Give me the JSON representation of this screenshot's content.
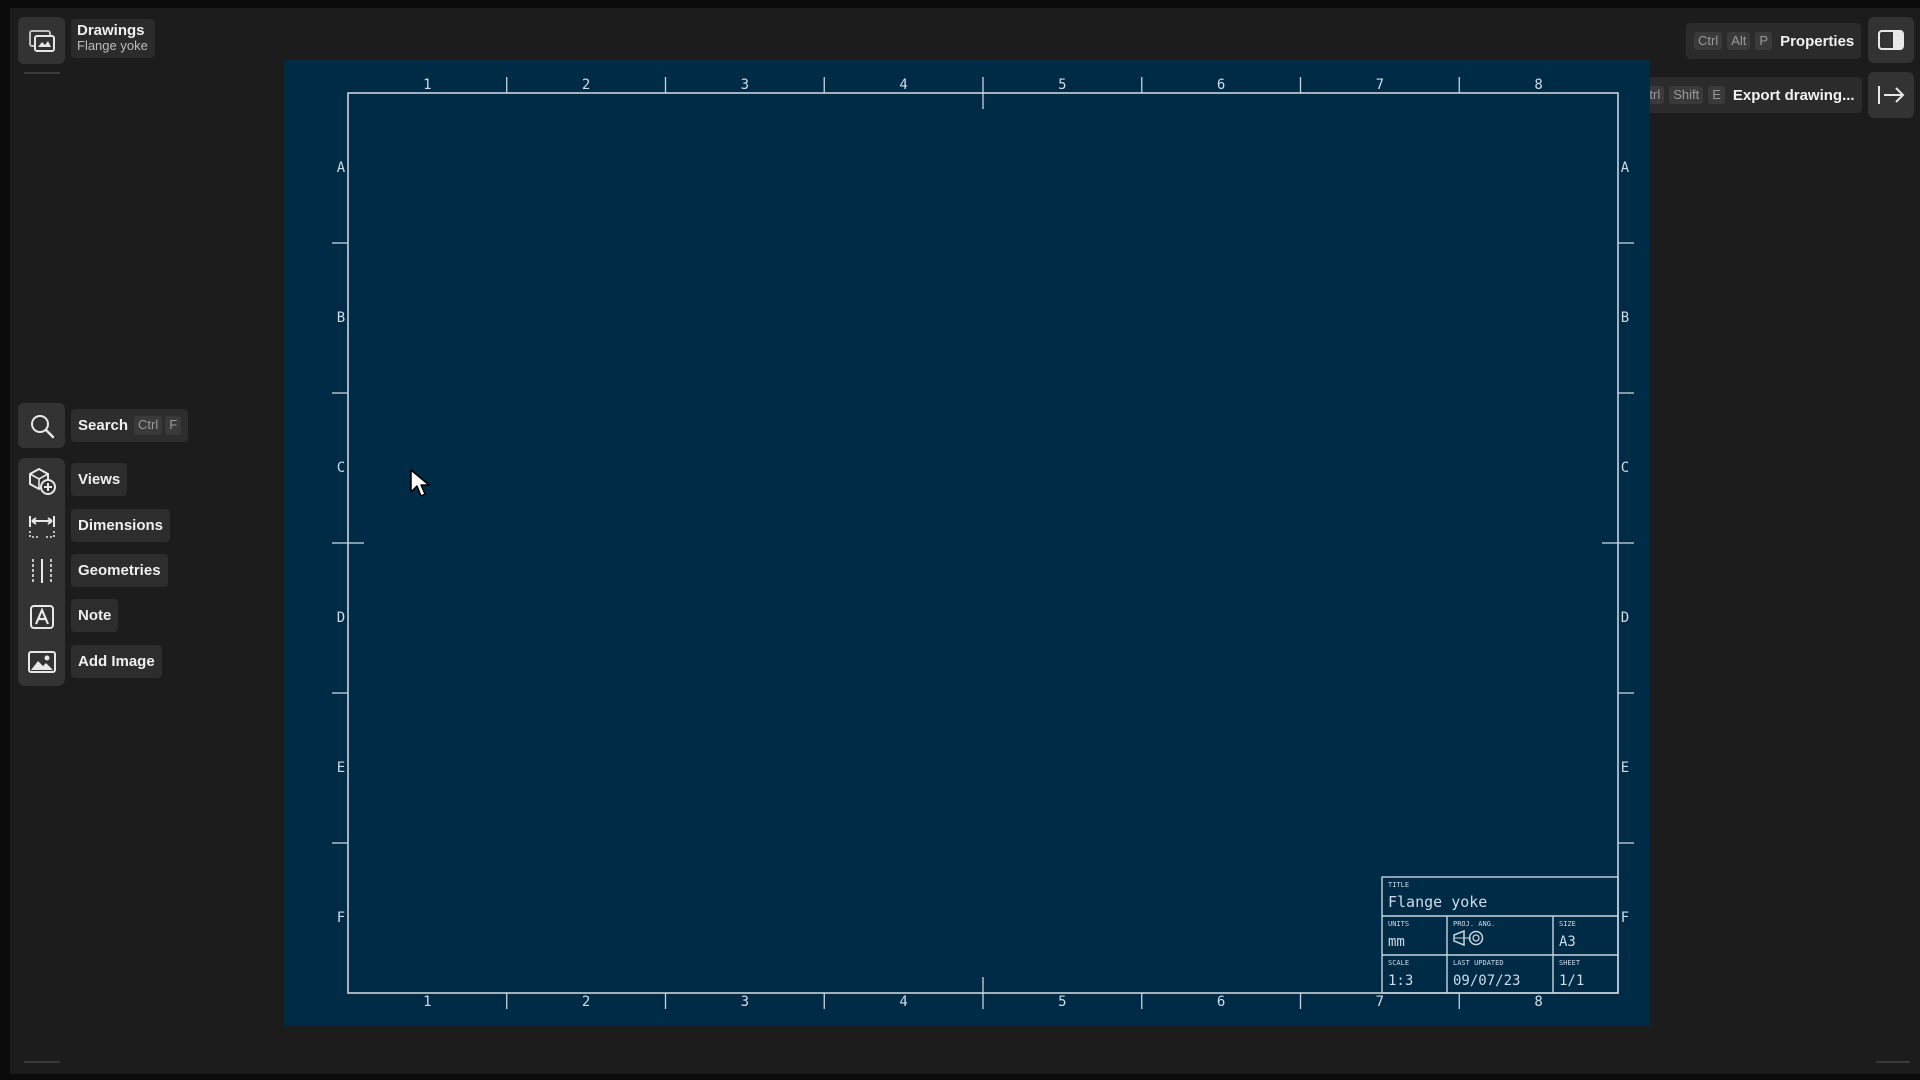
{
  "header": {
    "title": "Drawings",
    "subtitle": "Flange yoke",
    "icon": "drawings-icon"
  },
  "toolbar": {
    "search": {
      "label": "Search",
      "shortcut": [
        "Ctrl",
        "F"
      ],
      "icon": "search-icon"
    },
    "items": [
      {
        "id": "views",
        "label": "Views",
        "icon": "views-add-icon"
      },
      {
        "id": "dimensions",
        "label": "Dimensions",
        "icon": "dimension-icon"
      },
      {
        "id": "geometries",
        "label": "Geometries",
        "icon": "geometry-icon"
      },
      {
        "id": "note",
        "label": "Note",
        "icon": "note-icon"
      },
      {
        "id": "add-image",
        "label": "Add Image",
        "icon": "image-icon"
      }
    ]
  },
  "actions": {
    "properties": {
      "label": "Properties",
      "shortcut": [
        "Ctrl",
        "Alt",
        "P"
      ],
      "icon": "panel-toggle-icon"
    },
    "export": {
      "label": "Export drawing...",
      "shortcut": [
        "Ctrl",
        "Shift",
        "E"
      ],
      "icon": "export-arrow-icon"
    }
  },
  "sheet": {
    "column_labels": [
      "1",
      "2",
      "3",
      "4",
      "5",
      "6",
      "7",
      "8"
    ],
    "row_labels": [
      "A",
      "B",
      "C",
      "D",
      "E",
      "F"
    ],
    "colors": {
      "sheet_background": "#002b47",
      "frame_line": "#c8d4de",
      "text": "#cfdbe6"
    },
    "title_block": {
      "title_caption": "TITLE",
      "title": "Flange yoke",
      "units_caption": "UNITS",
      "units": "mm",
      "projection_caption": "PROJ. ANG.",
      "size_caption": "SIZE",
      "size": "A3",
      "scale_caption": "SCALE",
      "scale": "1:3",
      "updated_caption": "LAST UPDATED",
      "updated": "09/07/23",
      "sheet_caption": "SHEET",
      "sheet": "1/1"
    }
  }
}
